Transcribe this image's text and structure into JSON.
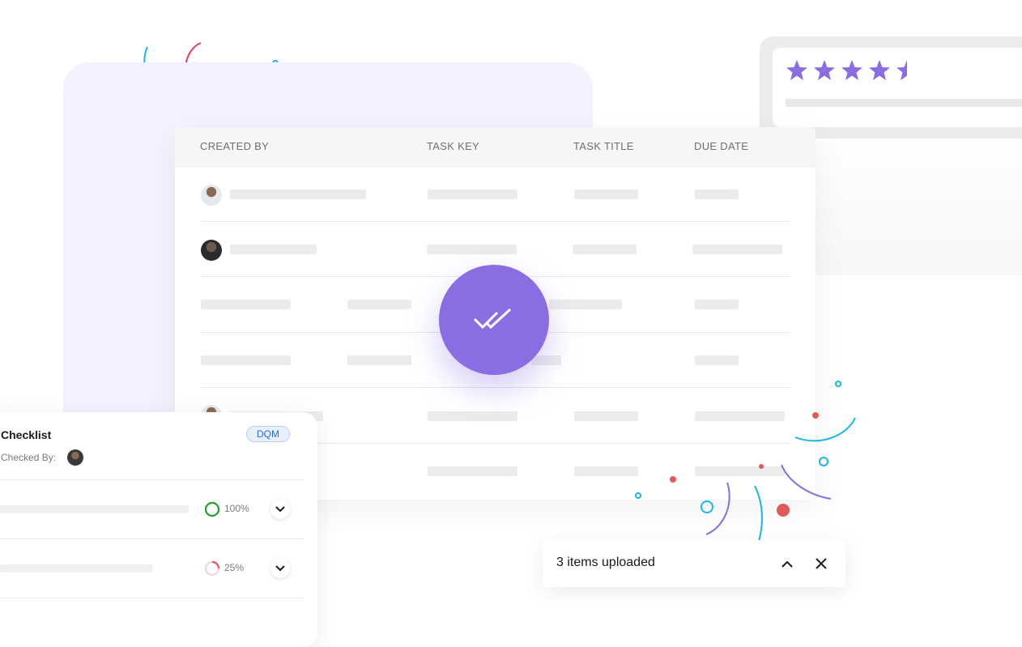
{
  "rating": {
    "value": 4.5,
    "max": 5,
    "star_color": "#8a6de3"
  },
  "table": {
    "headers": [
      "CREATED BY",
      "TASK KEY",
      "TASK TITLE",
      "DUE DATE"
    ]
  },
  "checklist": {
    "title": "Checklist",
    "checked_by_label": "Checked By:",
    "badge": "DQM",
    "items": [
      {
        "percent": "100%",
        "progress": 1.0,
        "ring_color": "#1fa32c"
      },
      {
        "percent": "25%",
        "progress": 0.25,
        "ring_color": "#ef4f5f"
      }
    ]
  },
  "upload_toast": {
    "text": "3 items uploaded"
  },
  "colors": {
    "accent": "#8a6de3",
    "panel_bg": "#f4f2fe",
    "confetti_red": "#e05a5a",
    "confetti_blue": "#1bb6e6"
  }
}
